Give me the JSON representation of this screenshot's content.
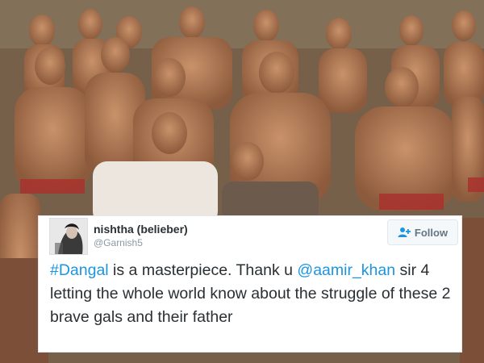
{
  "tweet": {
    "display_name": "nishtha (belieber)",
    "handle": "@Garnish5",
    "follow_label": "Follow",
    "text": {
      "hashtag": "#Dangal",
      "part1": " is a masterpiece. Thank u ",
      "mention": "@aamir_khan",
      "part2": " sir 4 letting the whole world know about the struggle of these 2 brave gals and their father"
    }
  },
  "icons": {
    "follow": "follow-person-plus-icon",
    "avatar": "profile-avatar"
  },
  "colors": {
    "link": "#1b95e0",
    "text": "#292f33",
    "secondary": "#8899a6"
  }
}
